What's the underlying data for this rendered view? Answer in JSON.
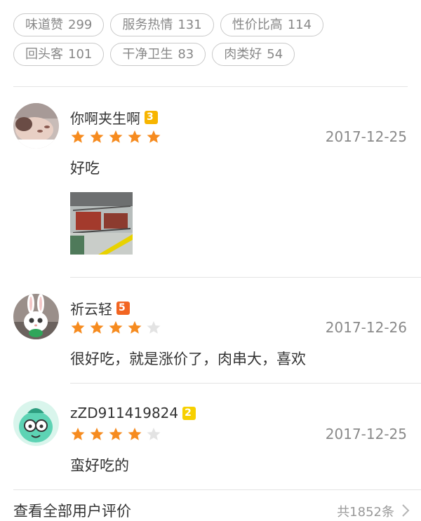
{
  "tags": [
    {
      "label": "味道赞",
      "count": "299"
    },
    {
      "label": "服务热情",
      "count": "131"
    },
    {
      "label": "性价比高",
      "count": "114"
    },
    {
      "label": "回头客",
      "count": "101"
    },
    {
      "label": "干净卫生",
      "count": "83"
    },
    {
      "label": "肉类好",
      "count": "54"
    }
  ],
  "reviews": [
    {
      "user": "你啊夹生啊",
      "level": "3",
      "level_color": "#f7b500",
      "rating": 5,
      "date": "2017-12-25",
      "text": "好吃",
      "has_photo": true
    },
    {
      "user": "祈云轻",
      "level": "5",
      "level_color": "#f26522",
      "rating": 4,
      "date": "2017-12-26",
      "text": "很好吃，就是涨价了，肉串大，喜欢",
      "has_photo": false
    },
    {
      "user": "zZD911419824",
      "level": "2",
      "level_color": "#f7d000",
      "rating": 4,
      "date": "2017-12-25",
      "text": "蛮好吃的",
      "has_photo": false
    }
  ],
  "footer": {
    "title": "查看全部用户评价",
    "count": "共1852条",
    "chevron_icon": "chevron-right-icon"
  },
  "colors": {
    "star_on": "#f68b1f",
    "star_off": "#e3e3e3"
  }
}
